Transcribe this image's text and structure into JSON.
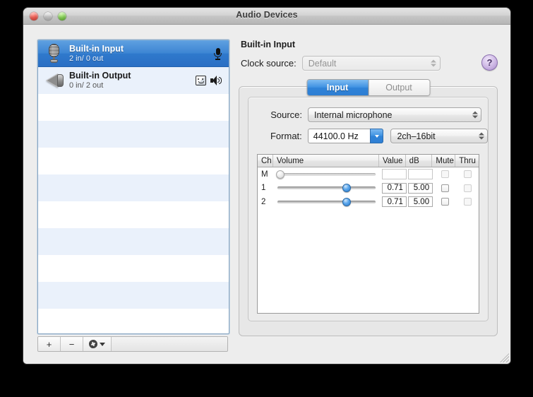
{
  "window": {
    "title": "Audio Devices",
    "traffic_lights": [
      "close",
      "minimize",
      "zoom"
    ]
  },
  "device_list": {
    "items": [
      {
        "name": "Built-in Input",
        "io": "2 in/ 0 out",
        "icon": "microphone-icon",
        "badges": [
          "mic-badge-icon"
        ],
        "selected": true
      },
      {
        "name": "Built-in Output",
        "io": "0 in/ 2 out",
        "icon": "speaker-icon",
        "badges": [
          "finder-face-icon",
          "speaker-badge-icon"
        ],
        "selected": false
      }
    ],
    "empty_rows": 9,
    "toolbar": {
      "add_label": "+",
      "remove_label": "−",
      "action_icon": "gear-icon"
    }
  },
  "detail": {
    "title": "Built-in Input",
    "clock_label": "Clock source:",
    "clock_value": "Default",
    "clock_disabled": true,
    "help_label": "?",
    "tabs": [
      {
        "label": "Input",
        "active": true
      },
      {
        "label": "Output",
        "active": false
      }
    ],
    "source_label": "Source:",
    "source_value": "Internal microphone",
    "format_label": "Format:",
    "format_rate": "44100.0 Hz",
    "format_channels": "2ch–16bit",
    "table": {
      "headers": [
        "Ch",
        "Volume",
        "Value",
        "dB",
        "Mute",
        "Thru"
      ],
      "rows": [
        {
          "ch": "M",
          "volume": 0,
          "value": "",
          "db": "",
          "mute": false,
          "thru": false,
          "enabled": false
        },
        {
          "ch": "1",
          "volume": 0.71,
          "value": "0.71",
          "db": "5.00",
          "mute": false,
          "thru": false,
          "enabled": true
        },
        {
          "ch": "2",
          "volume": 0.71,
          "value": "0.71",
          "db": "5.00",
          "mute": false,
          "thru": false,
          "enabled": true
        }
      ]
    }
  },
  "colors": {
    "selection_blue": "#3d85d3",
    "tab_active_blue": "#3f92e2",
    "help_purple": "#cdb7e4",
    "stripe_blue": "#eaf1fb"
  }
}
